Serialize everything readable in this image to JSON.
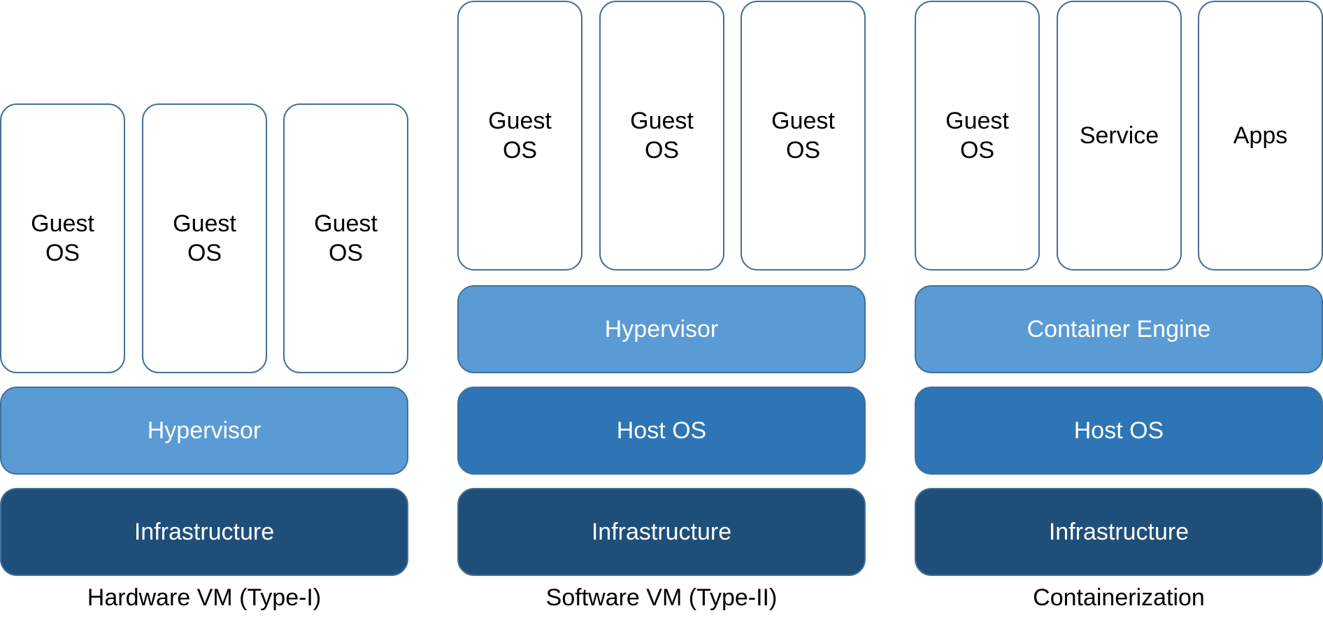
{
  "colors": {
    "guest": "#ffffff",
    "hypervisor_engine": "#5b9bd5",
    "host_os": "#2e75b6",
    "infrastructure": "#1f4e79",
    "border": "#41719c"
  },
  "hardware_vm": {
    "caption": "Hardware VM (Type-I)",
    "guests": [
      "Guest\nOS",
      "Guest\nOS",
      "Guest\nOS"
    ],
    "hypervisor": "Hypervisor",
    "infrastructure": "Infrastructure"
  },
  "software_vm": {
    "caption": "Software VM (Type-II)",
    "guests": [
      "Guest\nOS",
      "Guest\nOS",
      "Guest\nOS"
    ],
    "hypervisor": "Hypervisor",
    "host_os": "Host OS",
    "infrastructure": "Infrastructure"
  },
  "containerization": {
    "caption": "Containerization",
    "guests": [
      "Guest\nOS",
      "Service",
      "Apps"
    ],
    "engine": "Container Engine",
    "host_os": "Host OS",
    "infrastructure": "Infrastructure"
  }
}
